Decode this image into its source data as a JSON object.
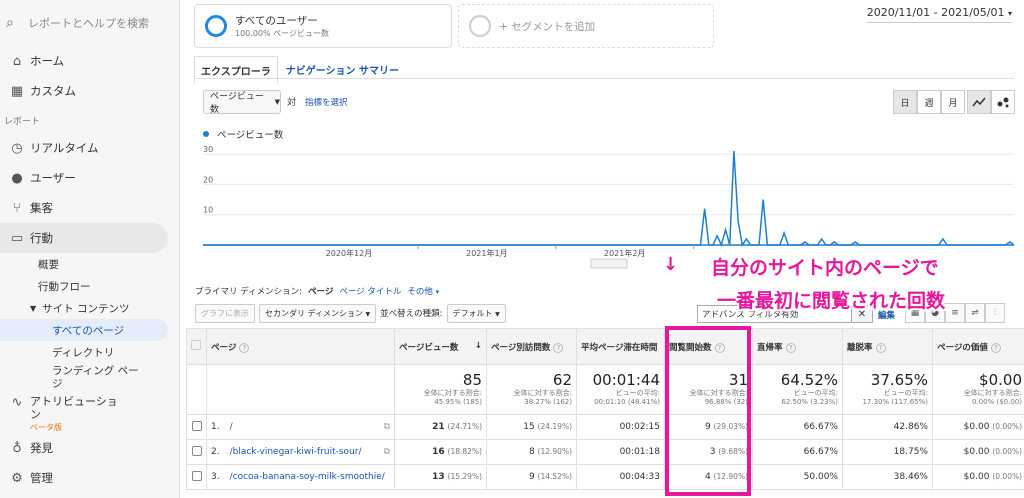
{
  "sidebar": {
    "search_placeholder": "レポートとヘルプを検索",
    "home": "ホーム",
    "custom": "カスタム",
    "reports_label": "レポート",
    "realtime": "リアルタイム",
    "users": "ユーザー",
    "acquisition": "集客",
    "behavior": "行動",
    "overview": "概要",
    "behavior_flow": "行動フロー",
    "site_content": "サイト コンテンツ",
    "all_pages": "すべてのページ",
    "directory": "ディレクトリ",
    "landing_pages_1": "ランディング ペー",
    "landing_pages_2": "ジ",
    "attribution_1": "アトリビューショ",
    "attribution_2": "ン",
    "beta": "ベータ版",
    "discover": "発見",
    "admin": "管理"
  },
  "segments": {
    "all_users_title": "すべてのユーザー",
    "all_users_sub": "100.00% ページビュー数",
    "add_segment": "+ セグメントを追加"
  },
  "date_range": "2020/11/01 - 2021/05/01",
  "tabs": {
    "explorer": "エクスプローラ",
    "nav_summary": "ナビゲーション サマリー"
  },
  "metric_select": "ページビュー数",
  "vs": "対",
  "select_metric": "指標を選択",
  "time_buttons": {
    "day": "日",
    "week": "週",
    "month": "月"
  },
  "chart_data": {
    "type": "line",
    "series": [
      {
        "name": "ページビュー数",
        "values": [
          0,
          0,
          0,
          0,
          0,
          0,
          0,
          0,
          0,
          0,
          0,
          0,
          0,
          0,
          0,
          0,
          0,
          0,
          0,
          0,
          0,
          0,
          0,
          0,
          0,
          0,
          0,
          0,
          0,
          0,
          0,
          0,
          0,
          0,
          0,
          0,
          0,
          0,
          0,
          0,
          0,
          0,
          0,
          0,
          0,
          0,
          0,
          0,
          0,
          0,
          0,
          0,
          0,
          0,
          0,
          0,
          0,
          0,
          0,
          0,
          0,
          0,
          0,
          0,
          0,
          0,
          0,
          0,
          0,
          0,
          0,
          0,
          0,
          0,
          0,
          0,
          0,
          0,
          0,
          0,
          0,
          0,
          0,
          0,
          0,
          0,
          0,
          0,
          0,
          0,
          0,
          0,
          0,
          0,
          0,
          0,
          0,
          0,
          0,
          0,
          0,
          0,
          0,
          0,
          0,
          0,
          0,
          0,
          0,
          0,
          0,
          0,
          0,
          0,
          0,
          0,
          0,
          0,
          0,
          0,
          12,
          0,
          0,
          3,
          0,
          5,
          0,
          31,
          8,
          0,
          2,
          0,
          0,
          0,
          15,
          0,
          0,
          0,
          0,
          4,
          0,
          0,
          0,
          0,
          1,
          0,
          0,
          0,
          2,
          0,
          0,
          1,
          0,
          0,
          0,
          0,
          1,
          0,
          0,
          0,
          0,
          0,
          0,
          0,
          0,
          0,
          0,
          0,
          0,
          0,
          0,
          0,
          0,
          0,
          0,
          0,
          0,
          2,
          0,
          0,
          0,
          0,
          0,
          0,
          0,
          0,
          0,
          0,
          0,
          0,
          0,
          0,
          0,
          1,
          0
        ]
      }
    ],
    "y_ticks": [
      "10",
      "20",
      "30"
    ],
    "x_labels": [
      "2020年12月",
      "2021年1月",
      "2021年2月"
    ],
    "ylim": [
      0,
      33
    ]
  },
  "dimension": {
    "label": "プライマリ ディメンション:",
    "page": "ページ",
    "page_title": "ページ タイトル",
    "other": "その他"
  },
  "controls": {
    "graph_btn": "グラフに表示",
    "secondary": "セカンダリ ディメンション",
    "sort_label": "並べ替えの種類:",
    "sort_value": "デフォルト",
    "filter": "アドバンス フィルタ有効",
    "edit": "編集"
  },
  "table": {
    "headers": [
      "ページ",
      "ページビュー数",
      "ページ別訪問数",
      "平均ページ滞在時間",
      "閲覧開始数",
      "直帰率",
      "離脱率",
      "ページの価値"
    ],
    "totals": [
      {
        "value": "85",
        "sub1": "全体に対する割合:",
        "sub2": "45.95% (185)"
      },
      {
        "value": "62",
        "sub1": "全体に対する割合:",
        "sub2": "38.27% (162)"
      },
      {
        "value": "00:01:44",
        "sub1": "ビューの平均:",
        "sub2": "00:01:10 (48.41%)"
      },
      {
        "value": "31",
        "sub1": "全体に対する割合:",
        "sub2": "96.88% (32)"
      },
      {
        "value": "64.52%",
        "sub1": "ビューの平均:",
        "sub2": "62.50% (3.23%)"
      },
      {
        "value": "37.65%",
        "sub1": "ビューの平均:",
        "sub2": "17.30% (117.65%)"
      },
      {
        "value": "$0.00",
        "sub1": "全体に対する割合:",
        "sub2": "0.00% ($0.00)"
      }
    ],
    "rows": [
      {
        "num": "1.",
        "page": "/",
        "pv": "21",
        "pv_pct": "(24.71%)",
        "uv": "15",
        "uv_pct": "(24.19%)",
        "time": "00:02:15",
        "ent": "9",
        "ent_pct": "(29.03%)",
        "bounce": "66.67%",
        "exit": "42.86%",
        "value": "$0.00",
        "val_pct": "(0.00%)"
      },
      {
        "num": "2.",
        "page": "/black-vinegar-kiwi-fruit-sour/",
        "pv": "16",
        "pv_pct": "(18.82%)",
        "uv": "8",
        "uv_pct": "(12.90%)",
        "time": "00:01:18",
        "ent": "3",
        "ent_pct": "(9.68%)",
        "bounce": "66.67%",
        "exit": "18.75%",
        "value": "$0.00",
        "val_pct": "(0.00%)"
      },
      {
        "num": "3.",
        "page": "/cocoa-banana-soy-milk-smoothie/",
        "pv": "13",
        "pv_pct": "(15.29%)",
        "uv": "9",
        "uv_pct": "(14.52%)",
        "time": "00:04:33",
        "ent": "4",
        "ent_pct": "(12.90%)",
        "bounce": "50.00%",
        "exit": "38.46%",
        "value": "$0.00",
        "val_pct": "(0.00%)"
      }
    ]
  },
  "annotation": {
    "arrow": "↓",
    "line1": "自分のサイト内のページで",
    "line2": "一番最初に閲覧された回数"
  }
}
